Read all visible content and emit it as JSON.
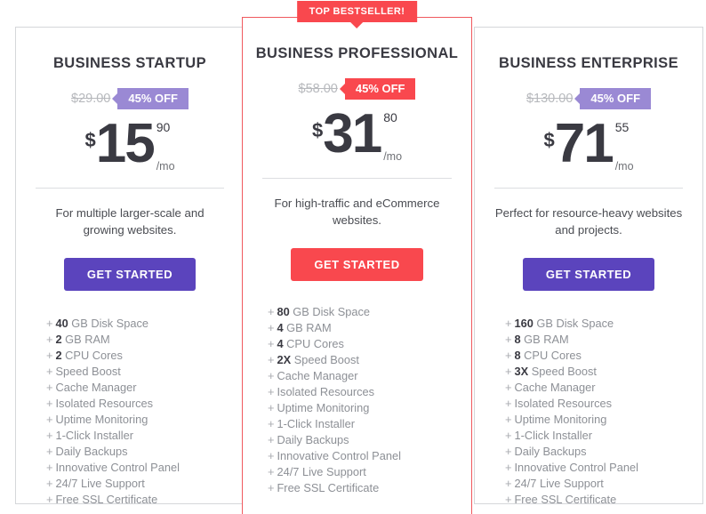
{
  "badge_labels": {
    "bestseller": "TOP BESTSELLER!"
  },
  "plans": [
    {
      "name": "BUSINESS STARTUP",
      "old_price": "$29.00",
      "discount": "45% OFF",
      "currency": "$",
      "price": "15",
      "cents": "90",
      "period": "/mo",
      "description": "For multiple larger-scale and growing websites.",
      "cta_label": "GET STARTED",
      "accent_color": "#5b44bd",
      "badge_color": "#9a89d4",
      "features": [
        {
          "plus": "+",
          "highlight": "40",
          "text": "GB Disk Space"
        },
        {
          "plus": "+",
          "highlight": "2",
          "text": "GB RAM"
        },
        {
          "plus": "+",
          "highlight": "2",
          "text": "CPU Cores"
        },
        {
          "plus": "+",
          "highlight": "",
          "text": "Speed Boost"
        },
        {
          "plus": "+",
          "highlight": "",
          "text": "Cache Manager"
        },
        {
          "plus": "+",
          "highlight": "",
          "text": "Isolated Resources"
        },
        {
          "plus": "+",
          "highlight": "",
          "text": "Uptime Monitoring"
        },
        {
          "plus": "+",
          "highlight": "",
          "text": "1-Click Installer"
        },
        {
          "plus": "+",
          "highlight": "",
          "text": "Daily Backups"
        },
        {
          "plus": "+",
          "highlight": "",
          "text": "Innovative Control Panel"
        },
        {
          "plus": "+",
          "highlight": "",
          "text": "24/7 Live Support"
        },
        {
          "plus": "+",
          "highlight": "",
          "text": "Free SSL Certificate"
        }
      ]
    },
    {
      "name": "BUSINESS PROFESSIONAL",
      "old_price": "$58.00",
      "discount": "45% OFF",
      "currency": "$",
      "price": "31",
      "cents": "80",
      "period": "/mo",
      "description": "For high-traffic and eCommerce websites.",
      "cta_label": "GET STARTED",
      "accent_color": "#f9484e",
      "badge_color": "#f9484e",
      "featured": true,
      "features": [
        {
          "plus": "+",
          "highlight": "80",
          "text": "GB Disk Space"
        },
        {
          "plus": "+",
          "highlight": "4",
          "text": "GB RAM"
        },
        {
          "plus": "+",
          "highlight": "4",
          "text": "CPU Cores"
        },
        {
          "plus": "+",
          "highlight": "2X",
          "text": "Speed Boost"
        },
        {
          "plus": "+",
          "highlight": "",
          "text": "Cache Manager"
        },
        {
          "plus": "+",
          "highlight": "",
          "text": "Isolated Resources"
        },
        {
          "plus": "+",
          "highlight": "",
          "text": "Uptime Monitoring"
        },
        {
          "plus": "+",
          "highlight": "",
          "text": "1-Click Installer"
        },
        {
          "plus": "+",
          "highlight": "",
          "text": "Daily Backups"
        },
        {
          "plus": "+",
          "highlight": "",
          "text": "Innovative Control Panel"
        },
        {
          "plus": "+",
          "highlight": "",
          "text": "24/7 Live Support"
        },
        {
          "plus": "+",
          "highlight": "",
          "text": "Free SSL Certificate"
        }
      ]
    },
    {
      "name": "BUSINESS ENTERPRISE",
      "old_price": "$130.00",
      "discount": "45% OFF",
      "currency": "$",
      "price": "71",
      "cents": "55",
      "period": "/mo",
      "description": "Perfect for resource-heavy websites and projects.",
      "cta_label": "GET STARTED",
      "accent_color": "#5b44bd",
      "badge_color": "#9a89d4",
      "features": [
        {
          "plus": "+",
          "highlight": "160",
          "text": "GB Disk Space"
        },
        {
          "plus": "+",
          "highlight": "8",
          "text": "GB RAM"
        },
        {
          "plus": "+",
          "highlight": "8",
          "text": "CPU Cores"
        },
        {
          "plus": "+",
          "highlight": "3X",
          "text": "Speed Boost"
        },
        {
          "plus": "+",
          "highlight": "",
          "text": "Cache Manager"
        },
        {
          "plus": "+",
          "highlight": "",
          "text": "Isolated Resources"
        },
        {
          "plus": "+",
          "highlight": "",
          "text": "Uptime Monitoring"
        },
        {
          "plus": "+",
          "highlight": "",
          "text": "1-Click Installer"
        },
        {
          "plus": "+",
          "highlight": "",
          "text": "Daily Backups"
        },
        {
          "plus": "+",
          "highlight": "",
          "text": "Innovative Control Panel"
        },
        {
          "plus": "+",
          "highlight": "",
          "text": "24/7 Live Support"
        },
        {
          "plus": "+",
          "highlight": "",
          "text": "Free SSL Certificate"
        }
      ]
    }
  ]
}
